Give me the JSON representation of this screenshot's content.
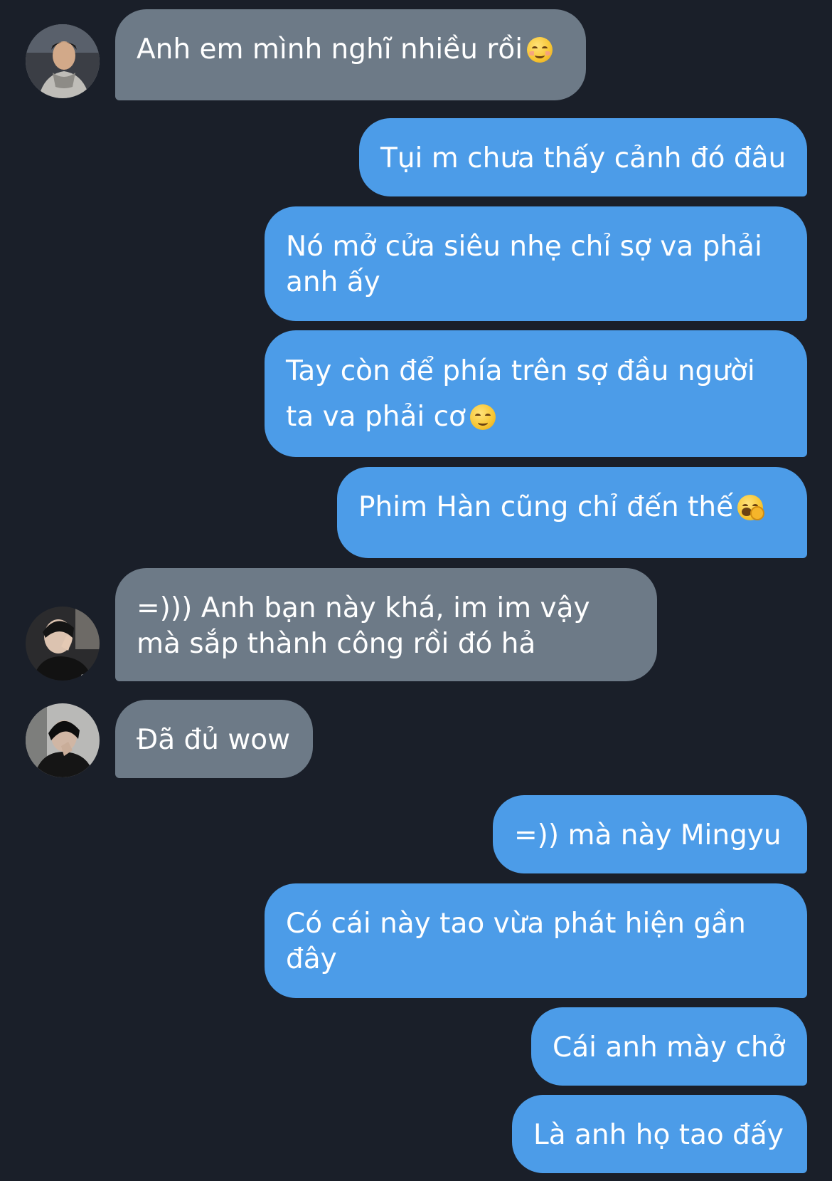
{
  "messages": [
    {
      "direction": "in",
      "text": "Anh em mình nghĩ nhiều rồi",
      "emoji": "smiling-face-icon"
    },
    {
      "direction": "out",
      "text": "Tụi m chưa thấy cảnh đó đâu"
    },
    {
      "direction": "out",
      "text": "Nó mở cửa siêu nhẹ chỉ sợ va phải anh ấy"
    },
    {
      "direction": "out",
      "text": "Tay còn để phía trên sợ đầu người ta va phải cơ",
      "emoji": "relieved-face-icon"
    },
    {
      "direction": "out",
      "text": "Phim Hàn cũng chỉ đến thế",
      "emoji": "yawning-face-icon"
    },
    {
      "direction": "in",
      "text": "=))) Anh bạn này khá, im im vậy mà sắp thành công rồi đó hả"
    },
    {
      "direction": "in",
      "text": "Đã đủ wow"
    },
    {
      "direction": "out",
      "text": "=)) mà này Mingyu"
    },
    {
      "direction": "out",
      "text": "Có cái này tao vừa phát hiện gần đây"
    },
    {
      "direction": "out",
      "text": "Cái anh mày chở"
    },
    {
      "direction": "out",
      "text": "Là anh họ tao đấy"
    }
  ],
  "colors": {
    "background": "#1a1f29",
    "incoming_bubble": "#6d7a87",
    "outgoing_bubble": "#4c9ce8",
    "text": "#ffffff"
  }
}
